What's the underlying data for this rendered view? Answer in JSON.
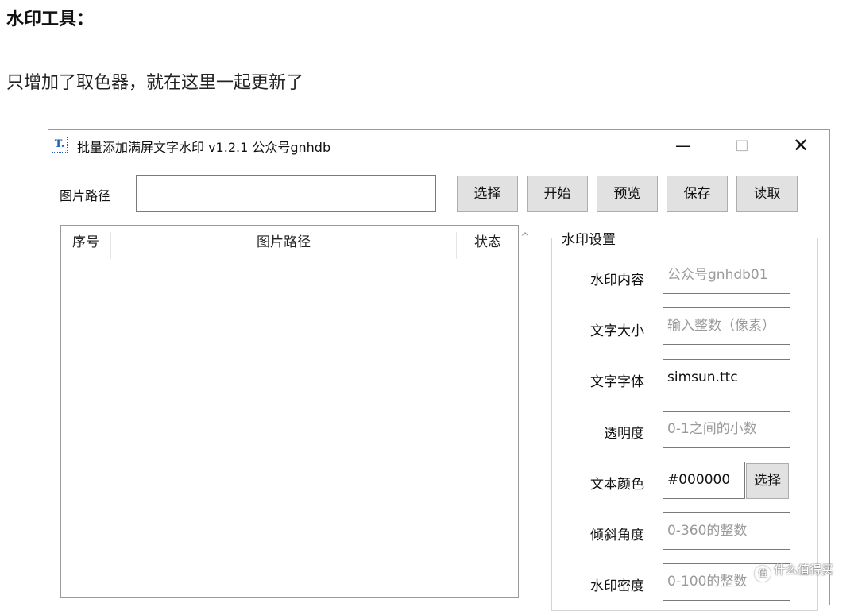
{
  "article": {
    "heading": "水印工具：",
    "text": "只增加了取色器，就在这里一起更新了"
  },
  "window": {
    "icon_glyph": "T.",
    "title": "批量添加满屏文字水印 v1.2.1  公众号gnhdb",
    "controls": {
      "minimize": "—",
      "maximize": "□",
      "close": "✕"
    }
  },
  "toolbar": {
    "path_label": "图片路径",
    "path_value": "",
    "buttons": {
      "select": "选择",
      "start": "开始",
      "preview": "预览",
      "save": "保存",
      "load": "读取"
    }
  },
  "file_list": {
    "columns": {
      "index": "序号",
      "path": "图片路径",
      "status": "状态"
    },
    "rows": [],
    "scroll_up_glyph": "^"
  },
  "settings": {
    "group_title": "水印设置",
    "fields": [
      {
        "label": "水印内容",
        "value": "",
        "placeholder": "公众号gnhdb01"
      },
      {
        "label": "文字大小",
        "value": "",
        "placeholder": "输入整数（像素）"
      },
      {
        "label": "文字字体",
        "value": "simsun.ttc",
        "placeholder": ""
      },
      {
        "label": "透明度",
        "value": "",
        "placeholder": "0-1之间的小数"
      },
      {
        "label": "文本颜色",
        "value": "#000000",
        "placeholder": ""
      },
      {
        "label": "倾斜角度",
        "value": "",
        "placeholder": "0-360的整数"
      },
      {
        "label": "水印密度",
        "value": "",
        "placeholder": "0-100的整数"
      }
    ],
    "color_pick_label": "选择"
  },
  "site_watermark": {
    "icon": "值",
    "text": "什么值得买"
  },
  "colors": {
    "accent": "#1d5fb8",
    "button_bg": "#e1e1e1",
    "border": "#7a7a7a",
    "placeholder": "#9a9a9a"
  }
}
